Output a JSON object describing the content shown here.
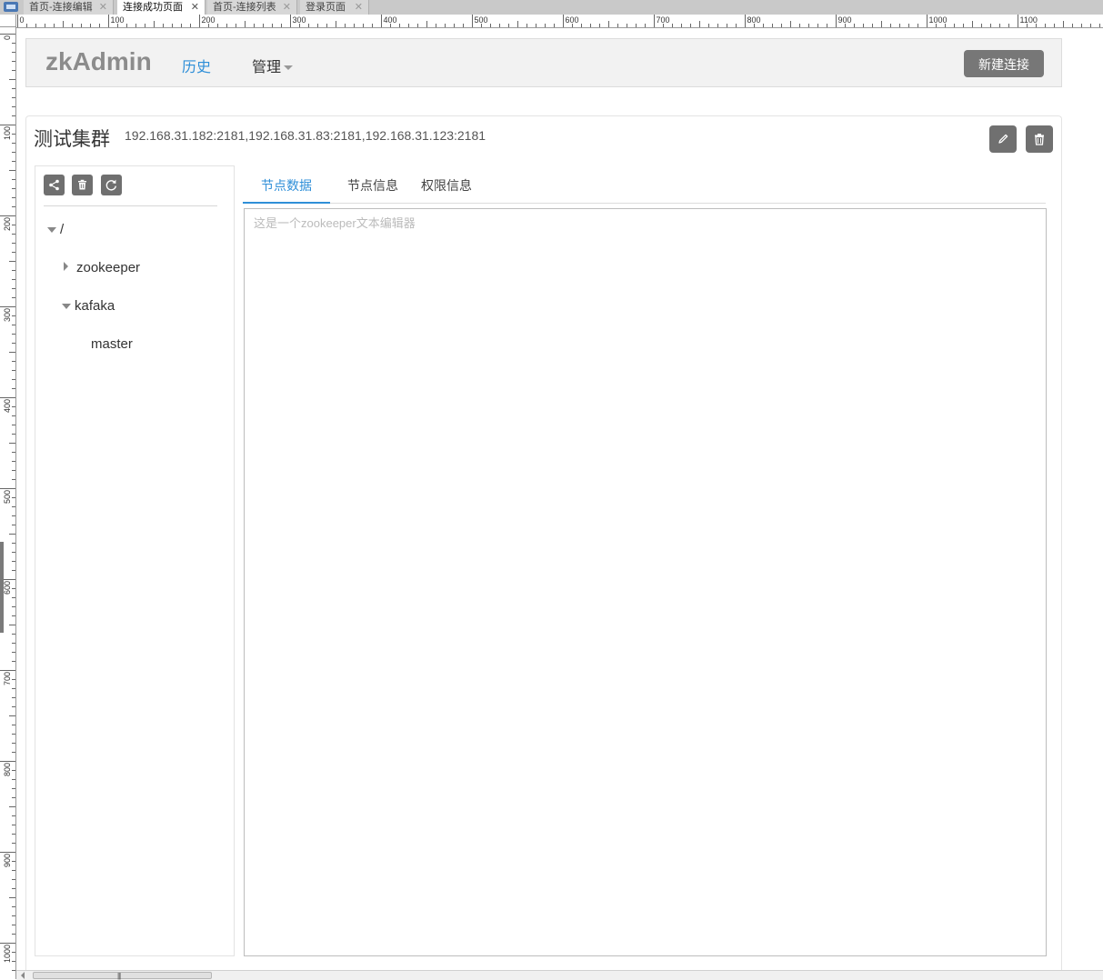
{
  "doc_tabs": [
    {
      "label": "首页-连接编辑",
      "active": false
    },
    {
      "label": "连接成功页面",
      "active": true
    },
    {
      "label": "首页-连接列表",
      "active": false
    },
    {
      "label": "登录页面",
      "active": false
    }
  ],
  "doc_tab_close": "✕",
  "ruler": {
    "top_labels": [
      "0",
      "100",
      "200",
      "300",
      "400",
      "500",
      "600",
      "700",
      "800",
      "900",
      "1000",
      "1100"
    ],
    "left_labels": [
      "0",
      "100",
      "200",
      "300",
      "400",
      "500",
      "600",
      "700",
      "800",
      "900",
      "1000"
    ]
  },
  "header": {
    "brand": "zkAdmin",
    "nav_history": "历史",
    "nav_manage": "管理",
    "new_connection_button": "新建连接"
  },
  "cluster": {
    "name": "测试集群",
    "address": "192.168.31.182:2181,192.168.31.83:2181,192.168.31.123:2181",
    "edit_icon": "pencil-icon",
    "delete_icon": "trash-icon"
  },
  "tree": {
    "toolbar_icons": [
      "share-icon",
      "trash-icon",
      "refresh-icon"
    ],
    "root": "/",
    "node_zookeeper": "zookeeper",
    "node_kafaka": "kafaka",
    "node_master": "master"
  },
  "tabs": {
    "node_data": "节点数据",
    "node_info": "节点信息",
    "acl_info": "权限信息"
  },
  "editor": {
    "placeholder": "这是一个zookeeper文本编辑器",
    "value": ""
  },
  "colors": {
    "accent": "#2f8fd8",
    "button_gray": "#777777",
    "navbar_bg": "#f2f2f2"
  }
}
